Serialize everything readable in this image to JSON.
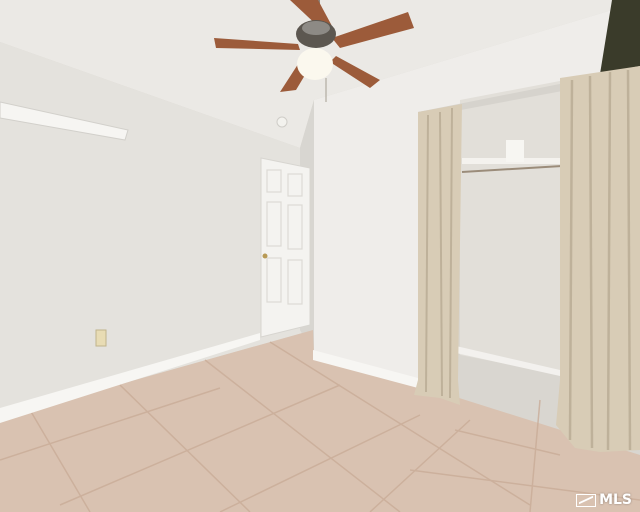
{
  "scene": {
    "description_tags": [
      "empty-bedroom",
      "ceiling-fan",
      "closet",
      "curtains",
      "tile-floor",
      "door"
    ]
  },
  "watermark": {
    "text": "MLS"
  },
  "colors": {
    "wall_left": "#e6e4e0",
    "wall_right": "#efedea",
    "ceiling": "#ebe9e5",
    "floor": "#d9c2b1",
    "grout": "#c9ac98",
    "door": "#f4f3f0",
    "curtain": "#d8ccb6",
    "curtain_shadow": "#b8ab94",
    "fan_blade": "#9c5b3a",
    "fan_light": "#fbf8ee",
    "baseboard": "#f7f6f3",
    "closet_top": "#3a3b2a"
  }
}
